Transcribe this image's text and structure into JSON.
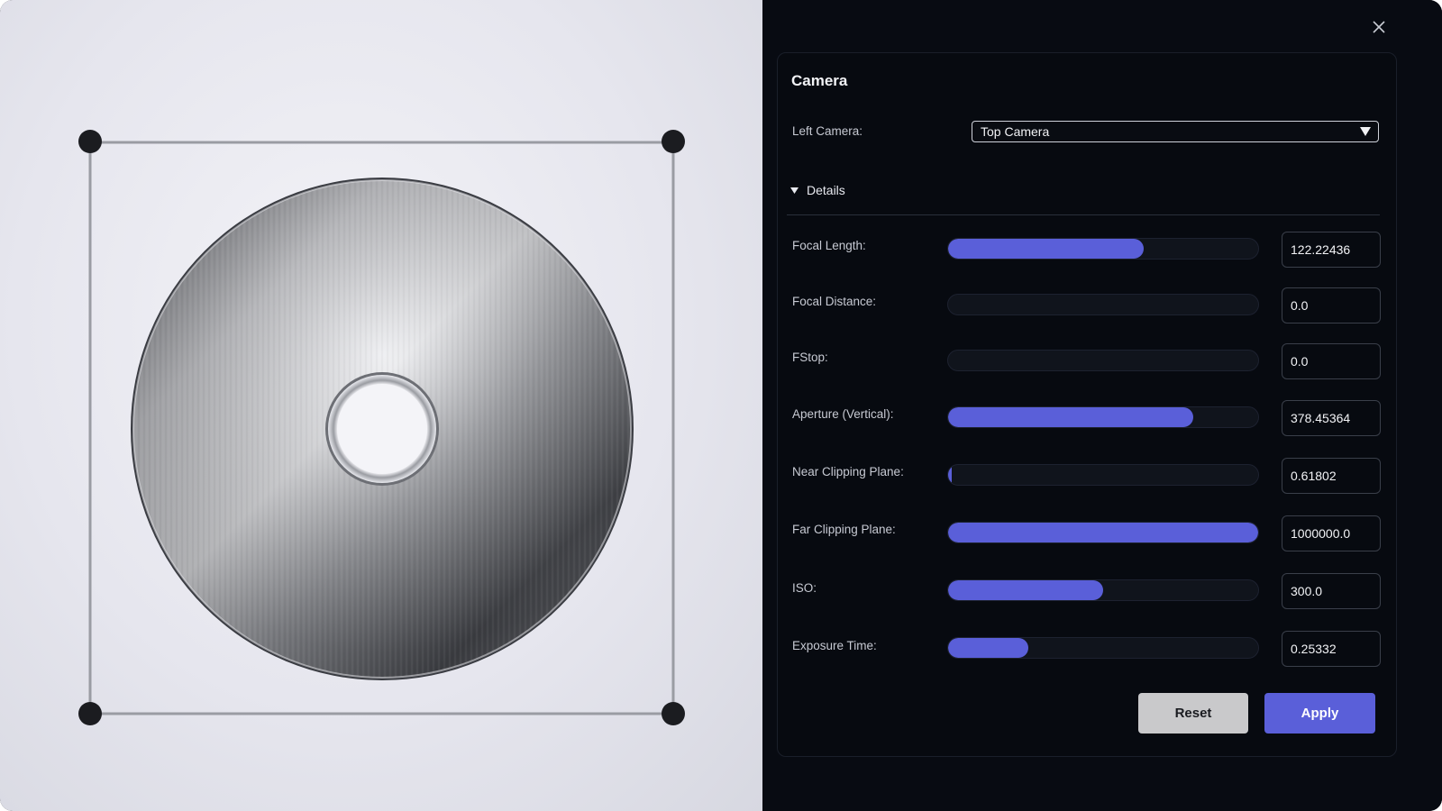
{
  "panel": {
    "title": "Camera",
    "left_camera": {
      "label": "Left Camera:",
      "selected": "Top Camera"
    },
    "details_label": "Details",
    "properties": [
      {
        "label": "Focal Length:",
        "value": "122.22436",
        "fill_fraction": 0.63
      },
      {
        "label": "Focal Distance:",
        "value": "0.0",
        "fill_fraction": 0.0
      },
      {
        "label": "FStop:",
        "value": "0.0",
        "fill_fraction": 0.0
      },
      {
        "label": "Aperture (Vertical):",
        "value": "378.45364",
        "fill_fraction": 0.79
      },
      {
        "label": "Near Clipping Plane:",
        "value": "0.61802",
        "fill_fraction": 0.01
      },
      {
        "label": "Far Clipping Plane:",
        "value": "1000000.0",
        "fill_fraction": 1.0
      },
      {
        "label": "ISO:",
        "value": "300.0",
        "fill_fraction": 0.5
      },
      {
        "label": "Exposure Time:",
        "value": "0.25332",
        "fill_fraction": 0.26
      }
    ],
    "buttons": {
      "reset": "Reset",
      "apply": "Apply"
    }
  },
  "icons": {
    "close": "close-icon",
    "dropdown": "dropdown-arrow-icon",
    "disclosure": "disclosure-triangle-icon"
  },
  "colors": {
    "accent": "#5a5fd9",
    "panel_bg": "#080b12",
    "viewport_bg": "#e6e6ee"
  }
}
